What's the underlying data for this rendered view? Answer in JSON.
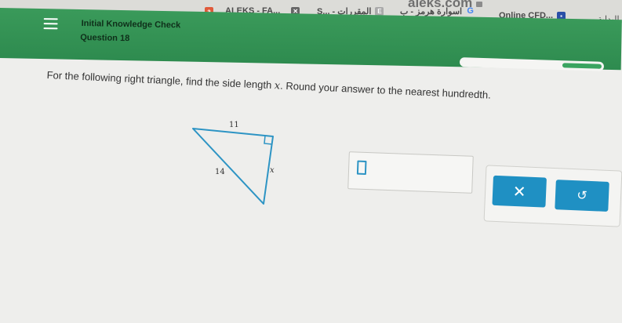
{
  "browser": {
    "url": "aleks.com",
    "tabs": [
      {
        "label": "ALEKS - FA...",
        "icon": "a-icon"
      },
      {
        "label": "S... - المقررات",
        "icon": "e-icon"
      },
      {
        "label": "اسوارة هرمز - ب",
        "icon": "g-icon"
      },
      {
        "label": "Online CFD...",
        "icon": "flag-icon"
      },
      {
        "label": "البداية",
        "icon": ""
      }
    ]
  },
  "header": {
    "title": "Initial Knowledge Check",
    "subtitle": "Question 18",
    "color": "#2e8b4f"
  },
  "progress": {
    "fraction": 0.28
  },
  "question": {
    "text_before": "For the following right triangle, find the side length ",
    "variable": "x",
    "text_after": ". Round your answer to the nearest hundredth."
  },
  "triangle": {
    "top_label": "11",
    "hyp_label": "14",
    "right_label": "x",
    "stroke_color": "#2d94c4"
  },
  "answer": {
    "value": ""
  },
  "buttons": {
    "clear_symbol": "✕",
    "undo_symbol": "↺",
    "color": "#1f90c3"
  }
}
